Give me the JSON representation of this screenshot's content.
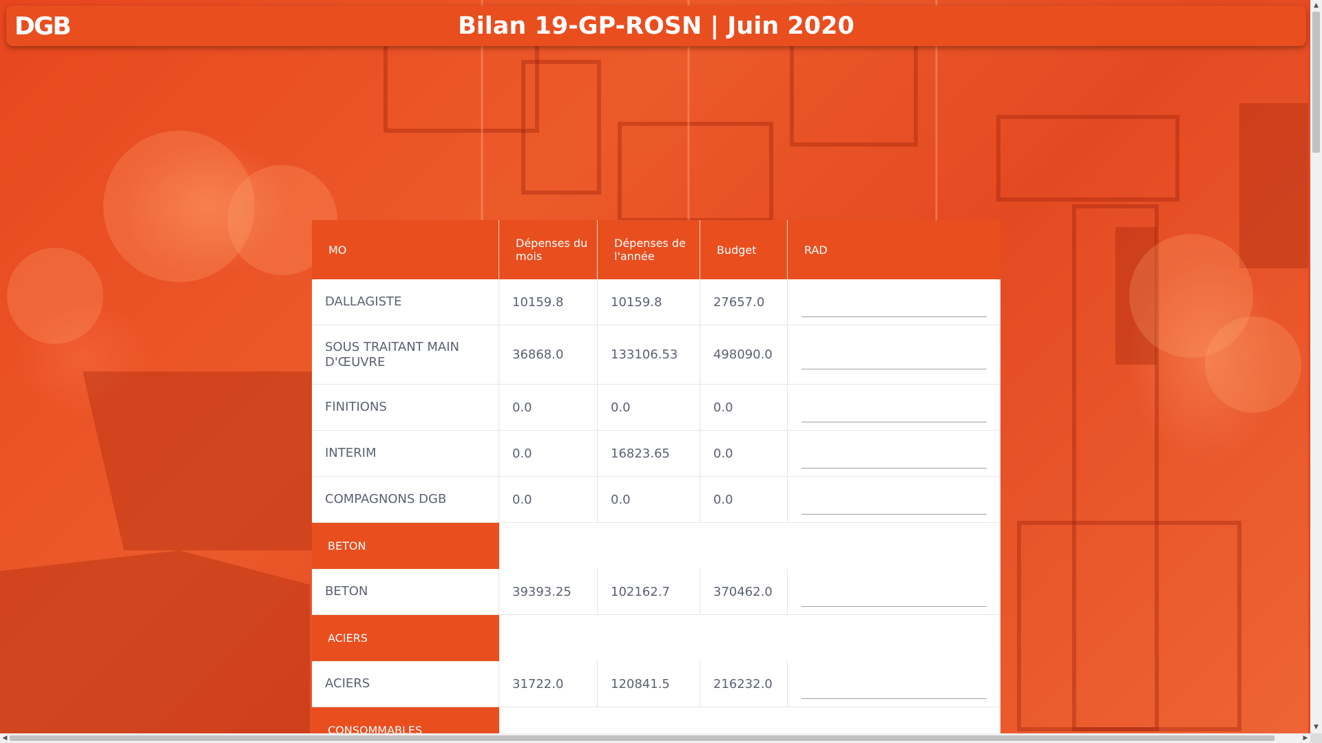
{
  "header": {
    "logo_text": "DGB",
    "title": "Bilan 19-GP-ROSN | Juin 2020"
  },
  "table": {
    "columns": [
      "MO",
      "Dépenses du mois",
      "Dépenses de l'année",
      "Budget",
      "RAD"
    ],
    "rows": [
      {
        "kind": "data",
        "label": "DALLAGISTE",
        "month": "10159.8",
        "year": "10159.8",
        "budget": "27657.0",
        "rad": ""
      },
      {
        "kind": "data",
        "label": "SOUS TRAITANT MAIN D'ŒUVRE",
        "month": "36868.0",
        "year": "133106.53",
        "budget": "498090.0",
        "rad": ""
      },
      {
        "kind": "data",
        "label": "FINITIONS",
        "month": "0.0",
        "year": "0.0",
        "budget": "0.0",
        "rad": ""
      },
      {
        "kind": "data",
        "label": "INTERIM",
        "month": "0.0",
        "year": "16823.65",
        "budget": "0.0",
        "rad": ""
      },
      {
        "kind": "data",
        "label": "COMPAGNONS DGB",
        "month": "0.0",
        "year": "0.0",
        "budget": "0.0",
        "rad": ""
      },
      {
        "kind": "section",
        "label": "BETON"
      },
      {
        "kind": "data",
        "label": "BETON",
        "month": "39393.25",
        "year": "102162.7",
        "budget": "370462.0",
        "rad": ""
      },
      {
        "kind": "section",
        "label": "ACIERS"
      },
      {
        "kind": "data",
        "label": "ACIERS",
        "month": "31722.0",
        "year": "120841.5",
        "budget": "216232.0",
        "rad": ""
      },
      {
        "kind": "section",
        "label": "CONSOMMABLES"
      }
    ]
  },
  "colors": {
    "accent": "#e94e1f",
    "text": "#5a6170",
    "background": "#e6451f"
  },
  "icons": {
    "scroll_up": "▲",
    "scroll_down": "▼",
    "scroll_left": "◀",
    "scroll_right": "▶"
  }
}
